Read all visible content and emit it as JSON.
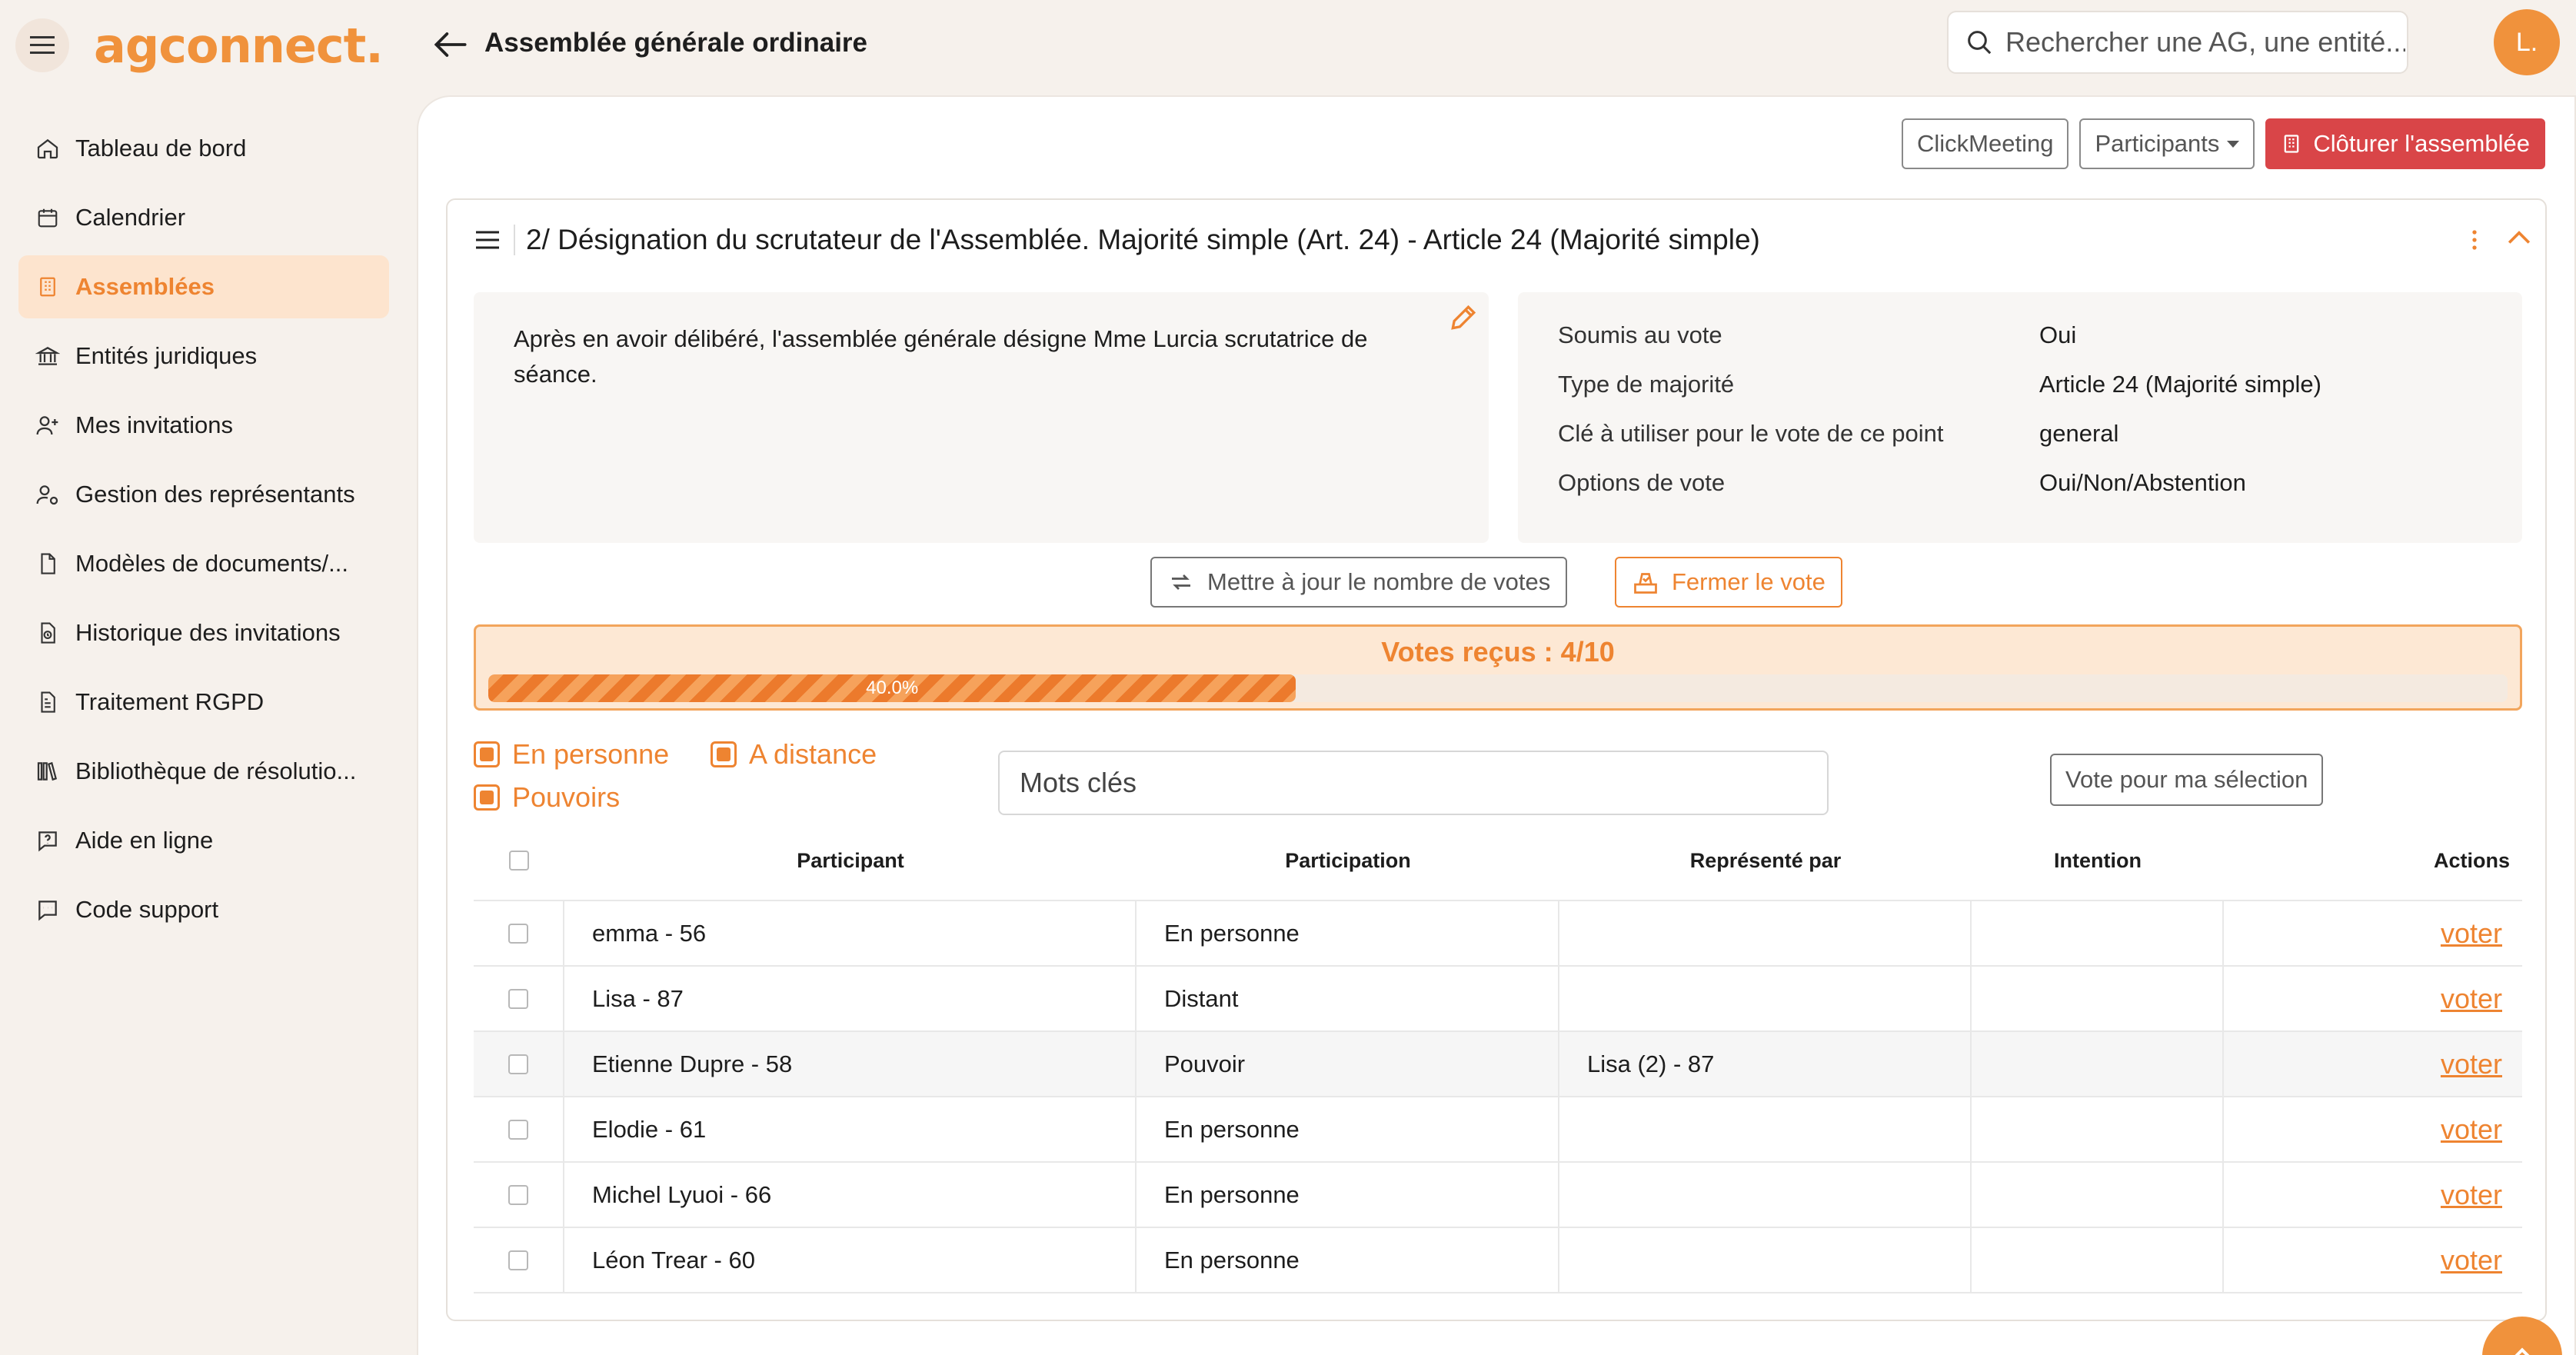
{
  "app": {
    "logo": "agconnect.",
    "page_title": "Assemblée générale ordinaire"
  },
  "search": {
    "placeholder": "Rechercher une AG, une entité..."
  },
  "user": {
    "avatar_initial": "L."
  },
  "sidebar": {
    "items": [
      {
        "label": "Tableau de bord",
        "icon": "home-icon",
        "active": false
      },
      {
        "label": "Calendrier",
        "icon": "calendar-icon",
        "active": false
      },
      {
        "label": "Assemblées",
        "icon": "building-icon",
        "active": true
      },
      {
        "label": "Entités juridiques",
        "icon": "bank-icon",
        "active": false
      },
      {
        "label": "Mes invitations",
        "icon": "user-plus-icon",
        "active": false
      },
      {
        "label": "Gestion des représentants",
        "icon": "user-gear-icon",
        "active": false
      },
      {
        "label": "Modèles de documents/...",
        "icon": "document-icon",
        "active": false
      },
      {
        "label": "Historique des invitations",
        "icon": "file-clock-icon",
        "active": false
      },
      {
        "label": "Traitement RGPD",
        "icon": "file-shield-icon",
        "active": false
      },
      {
        "label": "Bibliothèque de résolutio...",
        "icon": "library-icon",
        "active": false
      },
      {
        "label": "Aide en ligne",
        "icon": "help-icon",
        "active": false
      },
      {
        "label": "Code support",
        "icon": "chat-icon",
        "active": false
      }
    ]
  },
  "toolbar": {
    "clickmeeting": "ClickMeeting",
    "participants": "Participants",
    "close_assembly": "Clôturer l'assemblée"
  },
  "resolution": {
    "title": "2/ Désignation du scrutateur de l'Assemblée. Majorité simple (Art. 24) - Article 24 (Majorité simple)",
    "description": "Après en avoir délibéré, l'assemblée générale désigne Mme Lurcia  scrutatrice de séance.",
    "info": [
      {
        "label": "Soumis au vote",
        "value": "Oui"
      },
      {
        "label": "Type de majorité",
        "value": "Article 24 (Majorité simple)"
      },
      {
        "label": "Clé à utiliser pour le vote de ce point",
        "value": "general"
      },
      {
        "label": "Options de vote",
        "value": "Oui/Non/Abstention"
      }
    ]
  },
  "vote": {
    "update_button": "Mettre à jour le nombre de votes",
    "close_button": "Fermer le vote",
    "received_label": "Votes reçus : 4/10",
    "progress_fraction": 0.4,
    "progress_text": "40.0%"
  },
  "filters": {
    "in_person": "En personne",
    "remote": "A distance",
    "proxies": "Pouvoirs",
    "keywords_placeholder": "Mots clés",
    "vote_selection": "Vote pour ma sélection"
  },
  "table": {
    "headers": [
      "Participant",
      "Participation",
      "Représenté par",
      "Intention",
      "Actions"
    ],
    "rows": [
      {
        "participant": "emma - 56",
        "participation": "En personne",
        "represented_by": "",
        "intention": "",
        "action": "voter"
      },
      {
        "participant": "Lisa - 87",
        "participation": "Distant",
        "represented_by": "",
        "intention": "",
        "action": "voter"
      },
      {
        "participant": "Etienne Dupre - 58",
        "participation": "Pouvoir",
        "represented_by": "Lisa (2) - 87",
        "intention": "",
        "action": "voter"
      },
      {
        "participant": "Elodie - 61",
        "participation": "En personne",
        "represented_by": "",
        "intention": "",
        "action": "voter"
      },
      {
        "participant": "Michel Lyuoi - 66",
        "participation": "En personne",
        "represented_by": "",
        "intention": "",
        "action": "voter"
      },
      {
        "participant": "Léon Trear - 60",
        "participation": "En personne",
        "represented_by": "",
        "intention": "",
        "action": "voter"
      }
    ]
  },
  "colors": {
    "accent": "#ee8431",
    "danger": "#d94548",
    "active_bg": "#fde4ce"
  }
}
